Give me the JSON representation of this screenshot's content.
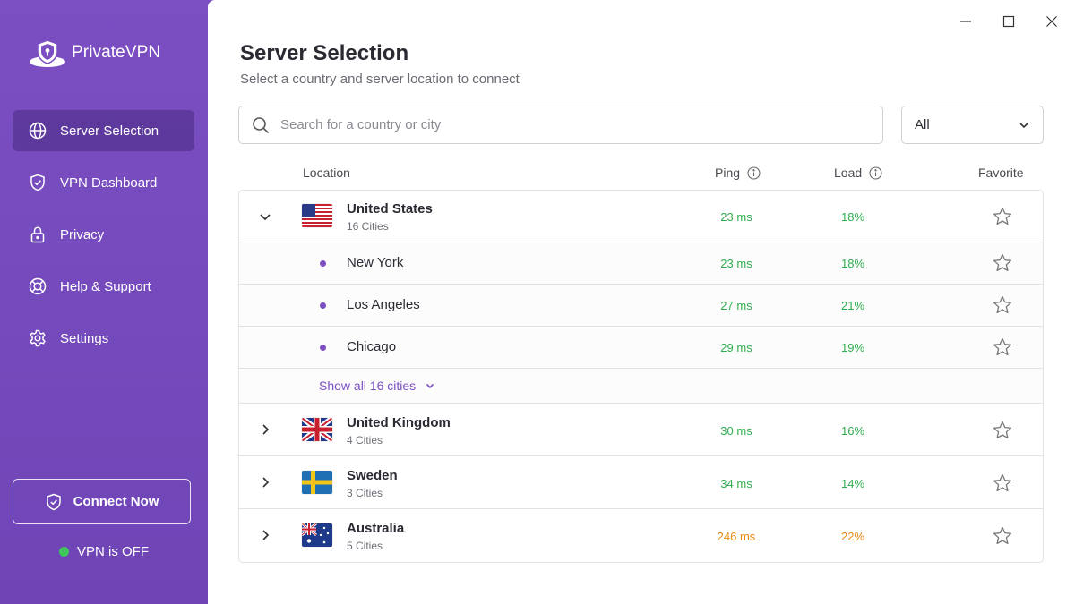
{
  "app": {
    "name": "PrivateVPN",
    "accent_color": "#7b4fc2",
    "sidebar_color": "#7a4fc0"
  },
  "sidebar": {
    "items": [
      {
        "label": "Server Selection",
        "icon": "globe-icon",
        "active": true
      },
      {
        "label": "VPN Dashboard",
        "icon": "shield-check-icon",
        "active": false
      },
      {
        "label": "Privacy",
        "icon": "lock-icon",
        "active": false
      },
      {
        "label": "Help & Support",
        "icon": "lifebuoy-icon",
        "active": false
      },
      {
        "label": "Settings",
        "icon": "gear-icon",
        "active": false
      }
    ],
    "connect_label": "Connect Now",
    "status_label": "VPN is OFF",
    "status_color": "#3fc75a"
  },
  "window_controls": [
    "minimize-icon",
    "maximize-icon",
    "close-icon"
  ],
  "header": {
    "title": "Server Selection",
    "subtitle": "Select a country and server location to connect"
  },
  "search": {
    "placeholder": "Search for a country or city",
    "value": ""
  },
  "filter": {
    "selected": "All"
  },
  "table": {
    "columns": {
      "location": "Location",
      "ping": "Ping",
      "load": "Load",
      "favorite": "Favorite"
    },
    "countries": [
      {
        "name": "United States",
        "cities_label": "16 Cities",
        "ping": "23 ms",
        "load": "18%",
        "expanded": true,
        "cities": [
          {
            "name": "New York",
            "ping": "23 ms",
            "load": "18%"
          },
          {
            "name": "Los Angeles",
            "ping": "27 ms",
            "load": "21%"
          },
          {
            "name": "Chicago",
            "ping": "29 ms",
            "load": "19%"
          }
        ],
        "show_all_label": "Show all 16 cities"
      },
      {
        "name": "United Kingdom",
        "cities_label": "4 Cities",
        "ping": "30 ms",
        "load": "16%",
        "expanded": false
      },
      {
        "name": "Sweden",
        "cities_label": "3 Cities",
        "ping": "34 ms",
        "load": "14%",
        "expanded": false
      },
      {
        "name": "Australia",
        "cities_label": "5 Cities",
        "ping": "246 ms",
        "load": "22%",
        "expanded": false,
        "status": "warning"
      }
    ]
  },
  "colors": {
    "good": "#2fae4e",
    "warning": "#e88a14"
  }
}
